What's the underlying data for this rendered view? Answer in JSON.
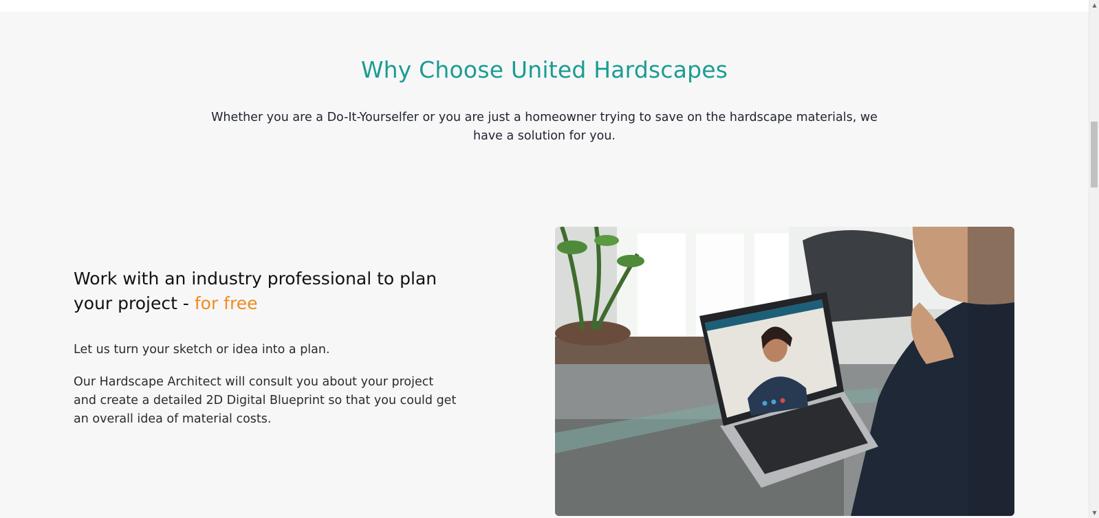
{
  "section": {
    "heading": "Why Choose United Hardscapes",
    "subheading": "Whether you are a Do-It-Yourselfer or you are just a homeowner trying to save on the hardscape materials, we have a solution for you."
  },
  "feature": {
    "title_main": "Work with an industry professional to plan your project - ",
    "title_accent": "for free",
    "paragraph_1": "Let us turn your sketch or idea into a plan.",
    "paragraph_2": "Our Hardscape Architect will consult you about your project and create a detailed 2D Digital Blueprint so that you could get an overall idea of material costs."
  },
  "colors": {
    "heading": "#1a9c94",
    "accent": "#ef8a1f",
    "background": "#f7f7f7"
  },
  "icons": {
    "scroll_up": "scroll-up-arrow-icon",
    "scroll_down": "scroll-down-arrow-icon"
  }
}
